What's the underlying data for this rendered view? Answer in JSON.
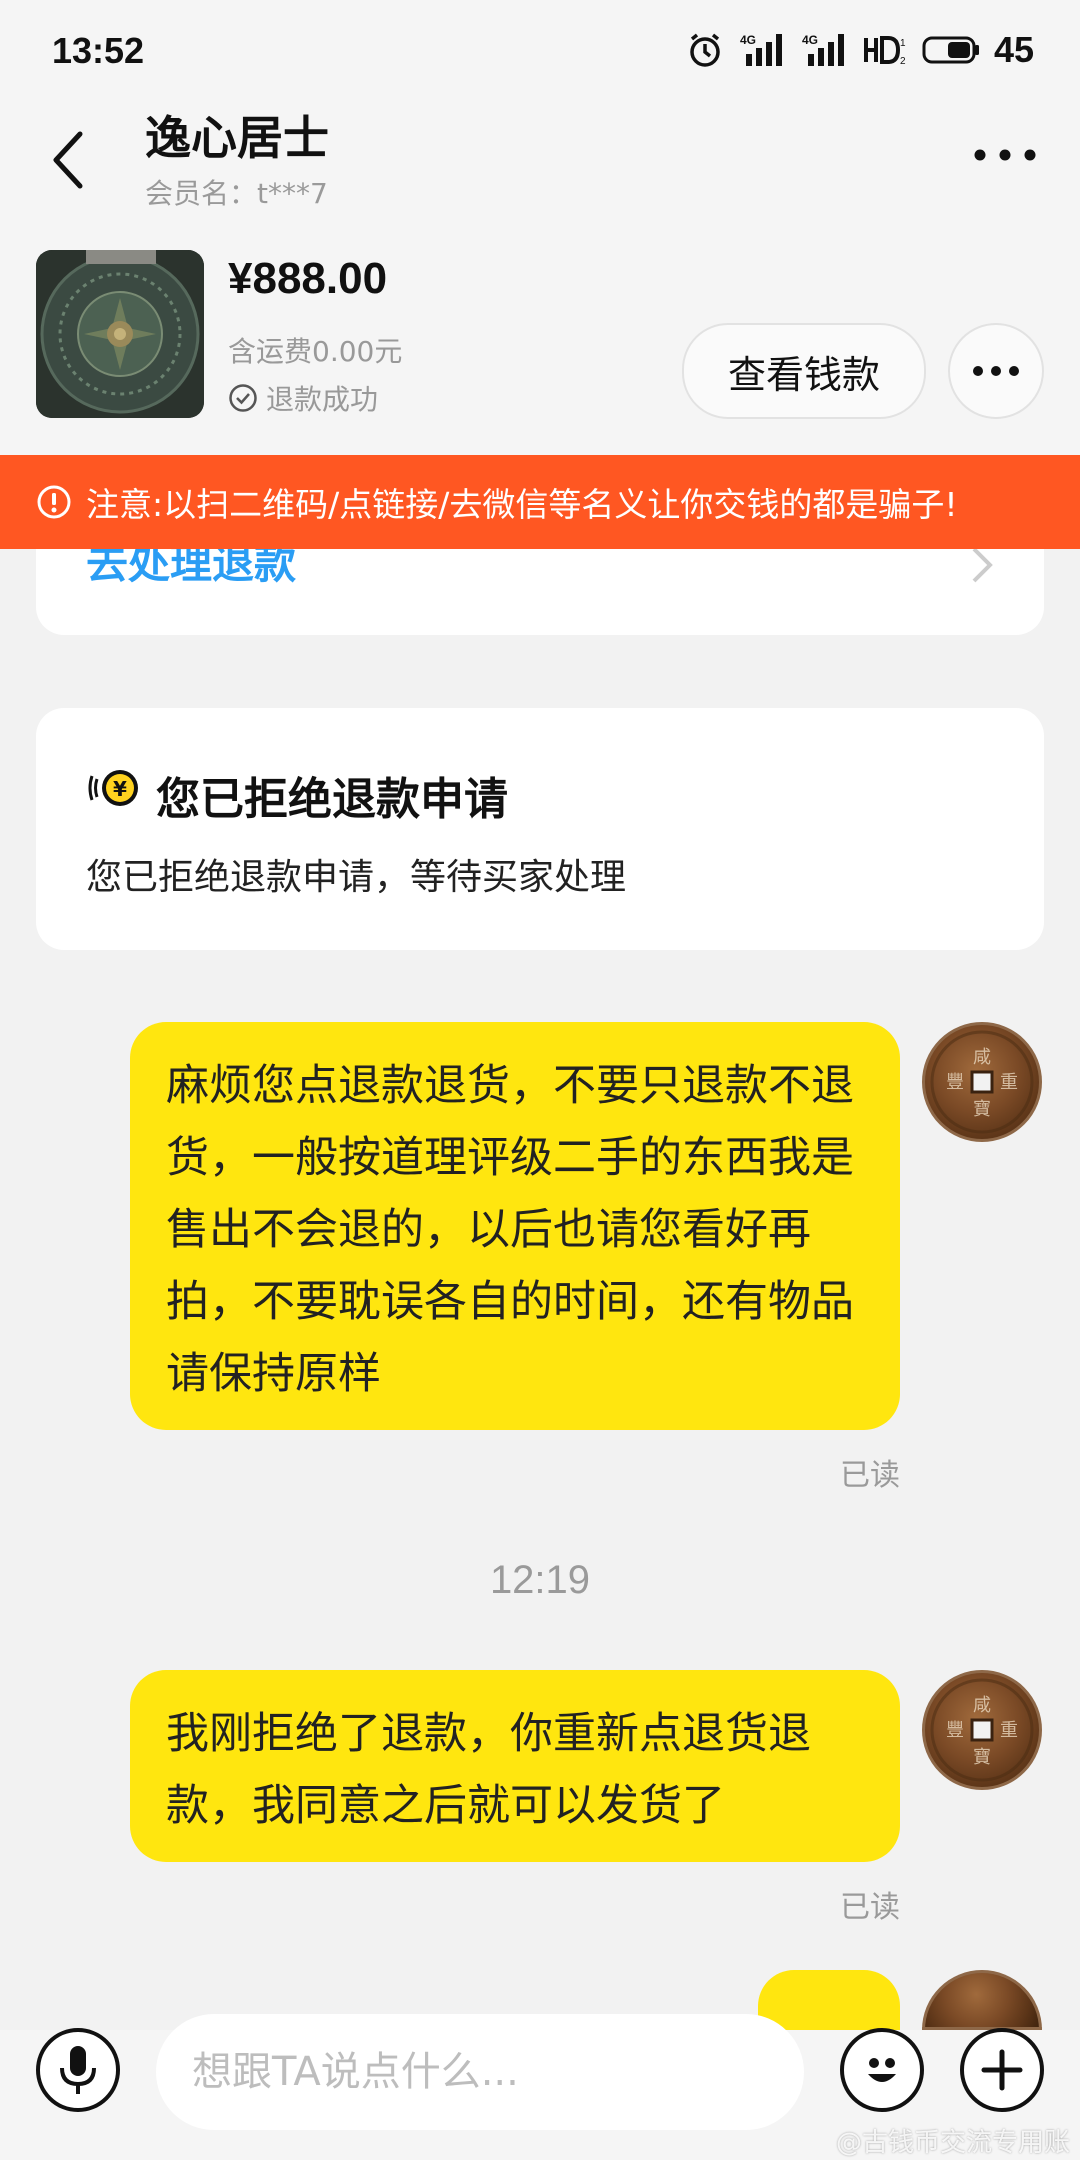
{
  "status_bar": {
    "time": "13:52",
    "battery": "45",
    "icons": [
      "alarm-icon",
      "signal-4g-icon",
      "signal-4g-icon",
      "hd-icon",
      "battery-icon"
    ]
  },
  "header": {
    "title": "逸心居士",
    "member": "会员名：t***7",
    "back_icon": "chevron-left-icon",
    "more_icon": "more-horizontal-icon"
  },
  "product": {
    "price": "¥888.00",
    "shipping": "含运费0.00元",
    "status": "退款成功",
    "status_icon": "check-circle-icon",
    "view_payment_label": "查看钱款",
    "more_icon": "more-horizontal-icon"
  },
  "warning": {
    "text": "注意:以扫二维码/点链接/去微信等名义让你交钱的都是骗子!",
    "icon": "alert-circle-icon",
    "color": "#ff5722"
  },
  "chat": {
    "refund_link": "去处理退款",
    "reject_card": {
      "title": "您已拒绝退款申请",
      "desc": "您已拒绝退款申请，等待买家处理",
      "icon": "yuan-coin-icon"
    },
    "messages": [
      {
        "text": "麻烦您点退款退货，不要只退款不退货，一般按道理评级二手的东西我是售出不会退的，以后也请您看好再拍，不要耽误各自的时间，还有物品请保持原样",
        "status": "已读"
      },
      {
        "text": "我刚拒绝了退款，你重新点退货退款，我同意之后就可以发货了",
        "status": "已读"
      }
    ],
    "timestamp": "12:19",
    "bubble_color": "#ffe60f"
  },
  "input_bar": {
    "placeholder": "想跟TA说点什么...",
    "voice_icon": "microphone-icon",
    "emoji_icon": "smile-icon",
    "add_icon": "plus-icon"
  },
  "watermark": "@古钱币交流专用账"
}
